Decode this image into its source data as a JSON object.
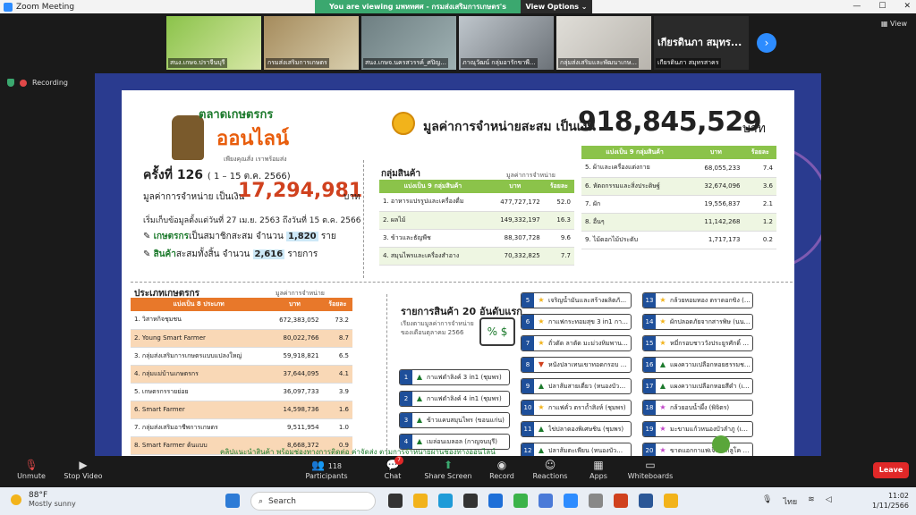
{
  "window": {
    "app_title": "Zoom Meeting",
    "share_banner": "You are viewing มพหทศศ - กรมส่งเสริมการเกษตร's screen",
    "view_options": "View Options",
    "view_label": "View",
    "recording": "Recording"
  },
  "participants_gallery": [
    {
      "name": "สนง.เกษจ.ปราจีนบุรี"
    },
    {
      "name": "กรมส่งเสริมการเกษตร"
    },
    {
      "name": "สนง.เกษจ.นครสวรรค์_ศปิญ..."
    },
    {
      "name": "ภาณุวัฒน์ กลุ่มอารักขาพื..."
    },
    {
      "name": "กลุ่มส่งเสริมและพัฒนาเกษ..."
    },
    {
      "name": "เกียรดินภา สมุทรสาคร",
      "big_name": "เกียรดินภา สมุทร..."
    }
  ],
  "slide": {
    "logo_title": "ตลาดเกษตรกร",
    "logo_online": "ออนไลน์",
    "logo_slogan": "เพียงคุณสั่ง เราพร้อมส่ง",
    "total_label": "มูลค่าการจำหน่ายสะสม เป็นเงิน",
    "total_value": "918,845,529",
    "total_unit": "บาท",
    "round_label": "ครั้งที่ 126",
    "round_range": "( 1 – 15 ต.ค. 2566)",
    "round_value_label": "มูลค่าการจำหน่าย เป็นเงิน",
    "round_value": "17,294,981",
    "round_unit": "บาท",
    "since": "เริ่มเก็บข้อมูลตั้งแต่วันที่ 27 เม.ย. 2563 ถึงวันที่ 15 ต.ค. 2566",
    "members_prefix": "เกษตรกร",
    "members_text": "เป็นสมาชิกสะสม จำนวน",
    "members_count": "1,820",
    "members_unit": "ราย",
    "products_prefix": "สินค้า",
    "products_text": "สะสมทั้งสิ้น จำนวน",
    "products_count": "2,616",
    "products_unit": "รายการ",
    "group_title": "กลุ่มสินค้า",
    "group_sub": "มูลค่าการจำหน่าย",
    "group_headers": [
      "แบ่งเป็น 9 กลุ่มสินค้า",
      "บาท",
      "ร้อยละ"
    ],
    "group_rows_left": [
      [
        "1. อาหารแปรรูปและเครื่องดื่ม",
        "477,727,172",
        "52.0"
      ],
      [
        "2. ผลไม้",
        "149,332,197",
        "16.3"
      ],
      [
        "3. ข้าวและธัญพืช",
        "88,307,728",
        "9.6"
      ],
      [
        "4. สมุนไพรและเครื่องสำอาง",
        "70,332,825",
        "7.7"
      ]
    ],
    "group_rows_right": [
      [
        "5. ผ้าและเครื่องแต่งกาย",
        "68,055,233",
        "7.4"
      ],
      [
        "6. หัตถกรรมและสิ่งประดิษฐ์",
        "32,674,096",
        "3.6"
      ],
      [
        "7. ผัก",
        "19,556,837",
        "2.1"
      ],
      [
        "8. อื่นๆ",
        "11,142,268",
        "1.2"
      ],
      [
        "9. ไม้ดอกไม้ประดับ",
        "1,717,173",
        "0.2"
      ]
    ],
    "farmer_title": "ประเภทเกษตรกร",
    "farmer_sub": "มูลค่าการจำหน่าย",
    "farmer_headers": [
      "แบ่งเป็น 8 ประเภท",
      "บาท",
      "ร้อยละ"
    ],
    "farmer_rows": [
      [
        "1. วิสาหกิจชุมชน",
        "672,383,052",
        "73.2"
      ],
      [
        "2. Young Smart Farmer",
        "80,022,766",
        "8.7"
      ],
      [
        "3. กลุ่มส่งเสริมการเกษตรแบบแปลงใหญ่",
        "59,918,821",
        "6.5"
      ],
      [
        "4. กลุ่มแม่บ้านเกษตรกร",
        "37,644,095",
        "4.1"
      ],
      [
        "5. เกษตรกรรายย่อย",
        "36,097,733",
        "3.9"
      ],
      [
        "6. Smart Farmer",
        "14,598,736",
        "1.6"
      ],
      [
        "7. กลุ่มส่งเสริมอาชีพการเกษตร",
        "9,511,954",
        "1.0"
      ],
      [
        "8. Smart Farmer ต้นแบบ",
        "8,668,372",
        "0.9"
      ]
    ],
    "top20_title": "รายการสินค้า 20 อันดับแรก",
    "top20_sub": "เรียงตามมูลค่าการจำหน่าย ของเดือนตุลาคม 2566",
    "top20": [
      {
        "n": "1",
        "t": "up",
        "label": "กาแฟดำลิงค์ 3 in1 (ชุมพร)"
      },
      {
        "n": "2",
        "t": "up",
        "label": "กาแฟดำลิงค์ 4 in1 (ชุมพร)"
      },
      {
        "n": "3",
        "t": "up",
        "label": "ข้าวแคบสมุนไพร (ขอนแก่น)"
      },
      {
        "n": "4",
        "t": "up",
        "label": "เมล่อนเมลอล (กาญจนบุรี)"
      },
      {
        "n": "5",
        "t": "st",
        "label": "เจริญน้ำมันเเละสร้างผลิตภัณฑ์ (ชุมพร)"
      },
      {
        "n": "6",
        "t": "st",
        "label": "กาแฟกระทอมสุข 3 in1 กาแฟผสมน้ำผึ้งอะโคมิเตอร์ (ชุมพร)"
      },
      {
        "n": "7",
        "t": "st",
        "label": "ถั่วตัด ลาตัด มะม่วงหิมพานต์ (ขอนแก่น)"
      },
      {
        "n": "8",
        "t": "dn",
        "label": "หนังปลาเทนเขาทอดกรอบ (สงขลา)"
      },
      {
        "n": "9",
        "t": "up",
        "label": "ปลาส้มสายเดี่ยว (หนองบัวลำภู)"
      },
      {
        "n": "10",
        "t": "st",
        "label": "กาแฟคั่ว ตราถ้ำสิงห์ (ชุมพร)"
      },
      {
        "n": "11",
        "t": "up",
        "label": "ไข่ปลาดองพิเศษชิน (ชุมพร)"
      },
      {
        "n": "12",
        "t": "up",
        "label": "ปลาส้มตะเพียน (หนองบัวลำภู)"
      },
      {
        "n": "13",
        "t": "st",
        "label": "กล้วยหอมทอง ตราดอกขิง (กระบี่)"
      },
      {
        "n": "14",
        "t": "st",
        "label": "ผักปลอดภัยจากสารพิษ (นนทบุรี)"
      },
      {
        "n": "15",
        "t": "st",
        "label": "หมี่กรอบชาววังประยูรศักดิ์ (สพบุรี)"
      },
      {
        "n": "16",
        "t": "up",
        "label": "แผงความเปลือกหอยธรรมชาติ (เลย)"
      },
      {
        "n": "17",
        "t": "up",
        "label": "แผงความเปลือกหอยสีดำ (เลย)"
      },
      {
        "n": "18",
        "t": "pk",
        "label": "กล้วยอบน้ำผึ้ง (พิจิตร)"
      },
      {
        "n": "19",
        "t": "pk",
        "label": "มะขามแก้วหนองบัวลำภู (เลย)"
      },
      {
        "n": "20",
        "t": "pk",
        "label": "ขาดแอกกาแฟเจ็บไวกลูโค ตราถ้ำสิงห์ (ชุมพร)"
      }
    ],
    "ticker": "คลิปแนะนำสินค้า พร้อมช่องทางการติดต่อ ค่าจัดส่ง ตามการจำหน่ายผ่านช่องทางออนไลน์"
  },
  "toolbar": {
    "unmute": "Unmute",
    "stop_video": "Stop Video",
    "participants": "Participants",
    "participants_count": "118",
    "chat": "Chat",
    "chat_badge": "7",
    "share_screen": "Share Screen",
    "record": "Record",
    "reactions": "Reactions",
    "apps": "Apps",
    "whiteboards": "Whiteboards",
    "leave": "Leave"
  },
  "taskbar": {
    "temp": "88°F",
    "weather": "Mostly sunny",
    "search": "Search",
    "time": "11:02",
    "date": "1/11/2566",
    "lang": "ไทย"
  }
}
